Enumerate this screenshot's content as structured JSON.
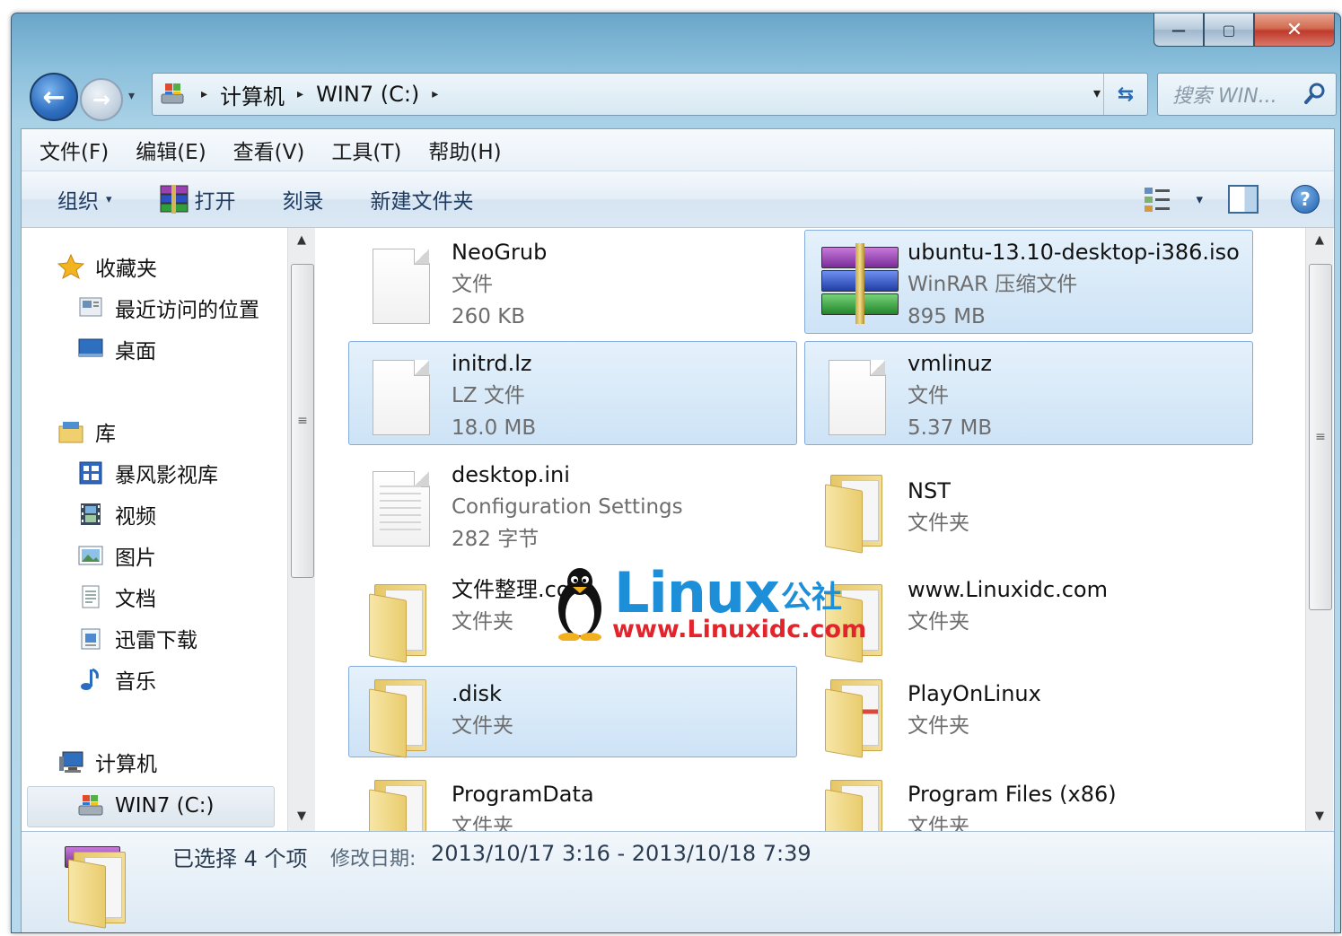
{
  "window": {
    "caption": {
      "minimize_glyph": "—",
      "maximize_glyph": "▢",
      "close_glyph": "✕"
    }
  },
  "navigation": {
    "back_glyph": "←",
    "forward_glyph": "→",
    "history_glyph": "▾",
    "address": {
      "segments": [
        "计算机",
        "WIN7 (C:)"
      ],
      "separator_glyph": "▸",
      "dropdown_glyph": "▾",
      "refresh_glyph": "⇆"
    },
    "search": {
      "placeholder": "搜索 WIN..."
    }
  },
  "menubar": {
    "items": [
      "文件(F)",
      "编辑(E)",
      "查看(V)",
      "工具(T)",
      "帮助(H)"
    ]
  },
  "toolbar": {
    "organize": "组织",
    "open": "打开",
    "burn": "刻录",
    "new_folder": "新建文件夹",
    "caret": "▾",
    "help_glyph": "?"
  },
  "sidebar": {
    "favorites": {
      "label": "收藏夹",
      "icon": "star-icon",
      "items": [
        {
          "label": "最近访问的位置",
          "icon": "recent-places-icon"
        },
        {
          "label": "桌面",
          "icon": "desktop-icon"
        }
      ]
    },
    "libraries": {
      "label": "库",
      "icon": "library-icon",
      "items": [
        {
          "label": "暴风影视库",
          "icon": "video-library-icon"
        },
        {
          "label": "视频",
          "icon": "film-icon"
        },
        {
          "label": "图片",
          "icon": "picture-icon"
        },
        {
          "label": "文档",
          "icon": "document-icon"
        },
        {
          "label": "迅雷下载",
          "icon": "download-icon"
        },
        {
          "label": "音乐",
          "icon": "music-icon"
        }
      ]
    },
    "computer": {
      "label": "计算机",
      "icon": "computer-icon",
      "items": [
        {
          "label": "WIN7 (C:)",
          "icon": "drive-icon",
          "selected": true
        }
      ]
    }
  },
  "scrollbar": {
    "up_glyph": "▲",
    "down_glyph": "▼",
    "grip_glyph": "≡"
  },
  "files": [
    {
      "name": "NeoGrub",
      "type": "文件",
      "size": "260 KB",
      "icon": "file-icon",
      "selected": false
    },
    {
      "name": "ubuntu-13.10-desktop-i386.iso",
      "type": "WinRAR 压缩文件",
      "size": "895 MB",
      "icon": "winrar-icon",
      "selected": true
    },
    {
      "name": "initrd.lz",
      "type": "LZ 文件",
      "size": "18.0 MB",
      "icon": "file-icon",
      "selected": true
    },
    {
      "name": "vmlinuz",
      "type": "文件",
      "size": "5.37 MB",
      "icon": "file-icon",
      "selected": true
    },
    {
      "name": "desktop.ini",
      "type": "Configuration Settings",
      "size": "282 字节",
      "icon": "settings-file-icon",
      "selected": false
    },
    {
      "name": "NST",
      "type": "文件夹",
      "icon": "folder-icon",
      "selected": false
    },
    {
      "name": "文件整理.com",
      "type": "文件夹",
      "icon": "folder-icon",
      "selected": false
    },
    {
      "name": "www.Linuxidc.com",
      "type": "文件夹",
      "icon": "folder-icon",
      "selected": false
    },
    {
      "name": ".disk",
      "type": "文件夹",
      "icon": "folder-icon",
      "selected": true
    },
    {
      "name": "PlayOnLinux",
      "type": "文件夹",
      "icon": "folder-icon",
      "selected": false
    },
    {
      "name": "ProgramData",
      "type": "文件夹",
      "icon": "folder-icon",
      "selected": false
    },
    {
      "name": "Program Files (x86)",
      "type": "文件夹",
      "icon": "folder-icon",
      "selected": false
    }
  ],
  "status": {
    "selection": "已选择 4 个项",
    "date_label": "修改日期:",
    "date_range": "2013/10/17 3:16 - 2013/10/18 7:39"
  },
  "watermark": {
    "title": "Linux",
    "title_cn": "公社",
    "url": "www.Linuxidc.com"
  },
  "colors": {
    "selection_fill": "#cde3f6",
    "selection_border": "#84acdd",
    "watermark_blue": "#1d8ed8",
    "watermark_red": "#e2242c"
  }
}
